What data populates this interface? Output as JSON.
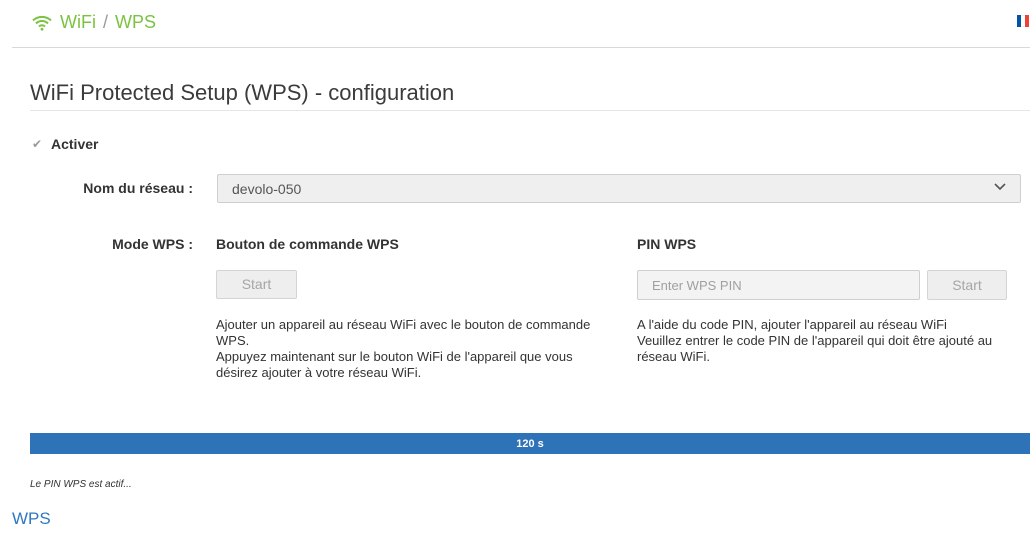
{
  "breadcrumb": {
    "section": "WiFi",
    "separator": "/",
    "current": "WPS"
  },
  "language": {
    "flag_colors": [
      "#0055a4",
      "#ffffff",
      "#ef4135"
    ],
    "icon": "france-flag-icon"
  },
  "page": {
    "title": "WiFi Protected Setup (WPS) - configuration"
  },
  "activate": {
    "label": "Activer",
    "checked": true
  },
  "network": {
    "label": "Nom du réseau :",
    "selected": "devolo-050"
  },
  "wps_mode": {
    "label": "Mode WPS :",
    "push_button": {
      "heading": "Bouton de commande WPS",
      "start_label": "Start",
      "description_line1": "Ajouter un appareil au réseau WiFi avec le bouton de commande WPS.",
      "description_line2": "Appuyez maintenant sur le bouton WiFi de l'appareil que vous désirez ajouter à votre réseau WiFi."
    },
    "pin": {
      "heading": "PIN WPS",
      "input_placeholder": "Enter WPS PIN",
      "input_value": "",
      "start_label": "Start",
      "description_line1": "A l'aide du code PIN, ajouter l'appareil au réseau WiFi",
      "description_line2": "Veuillez entrer le code PIN de l'appareil qui doit être ajouté au réseau WiFi."
    }
  },
  "progress": {
    "label": "120 s",
    "fraction": 1.0,
    "color": "#2e72b8"
  },
  "status": {
    "message": "Le PIN WPS est actif..."
  },
  "footer": {
    "label": "WPS"
  },
  "colors": {
    "accent_green": "#7cc242",
    "link_blue": "#2e78c2"
  }
}
